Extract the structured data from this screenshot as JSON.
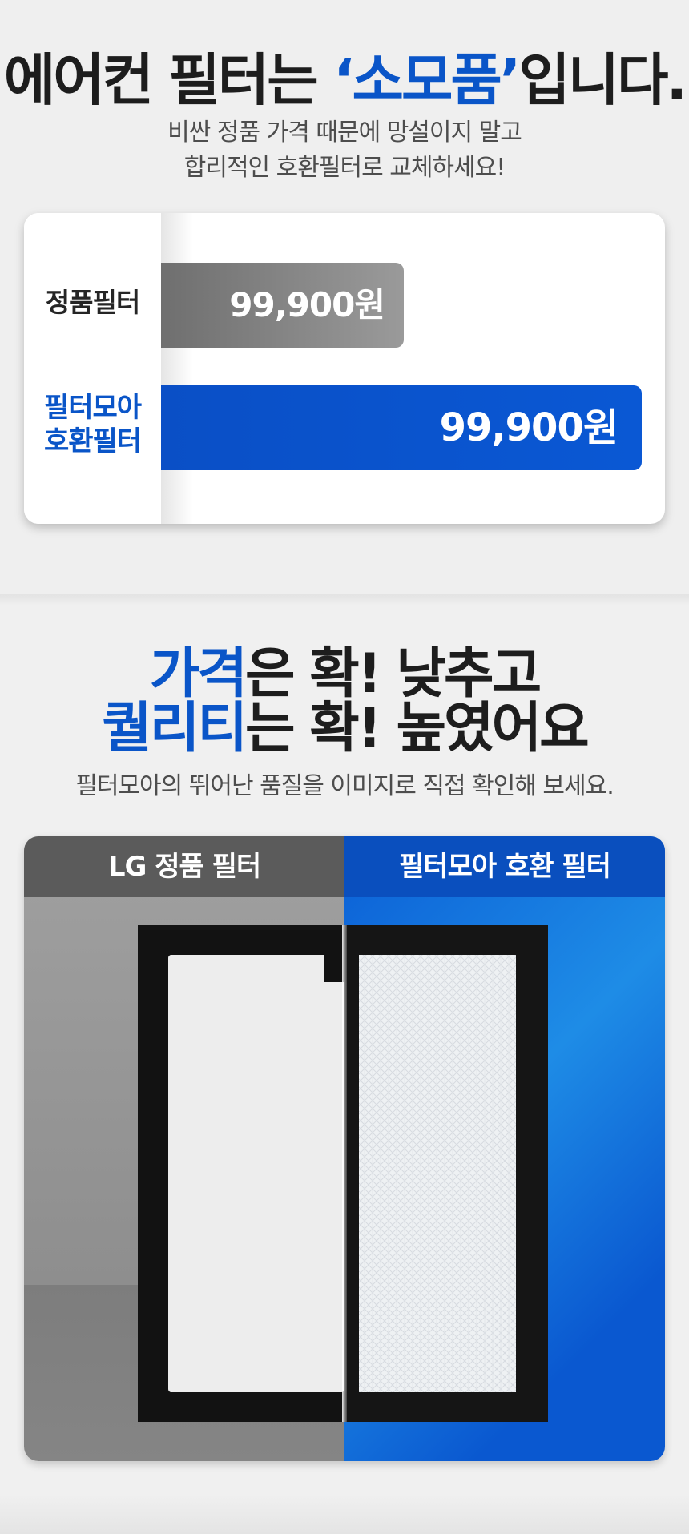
{
  "hero": {
    "headline_pre": "에어컨 필터는 ",
    "headline_highlight": "‘소모품’",
    "headline_post": "입니다.",
    "subtitle_line1": "비싼 정품 가격 때문에 망설이지 말고",
    "subtitle_line2": "합리적인 호환필터로 교체하세요!"
  },
  "price_compare": {
    "genuine_label": "정품필터",
    "genuine_price": "99,900원",
    "moa_label_line1": "필터모아",
    "moa_label_line2": "호환필터",
    "moa_price": "99,900원"
  },
  "quality": {
    "line1_highlight": "가격",
    "line1_rest": "은 확! 낮추고",
    "line2_highlight": "퀄리티",
    "line2_rest": "는 확! 높였어요",
    "subtitle": "필터모아의 뛰어난 품질을 이미지로 직접 확인해 보세요."
  },
  "filter_compare": {
    "left_header": "LG 정품 필터",
    "right_header": "필터모아 호환 필터"
  },
  "colors": {
    "accent_blue": "#0a55c8",
    "text_dark": "#1d1d1d",
    "genuine_gray": "#7f7f7f"
  }
}
